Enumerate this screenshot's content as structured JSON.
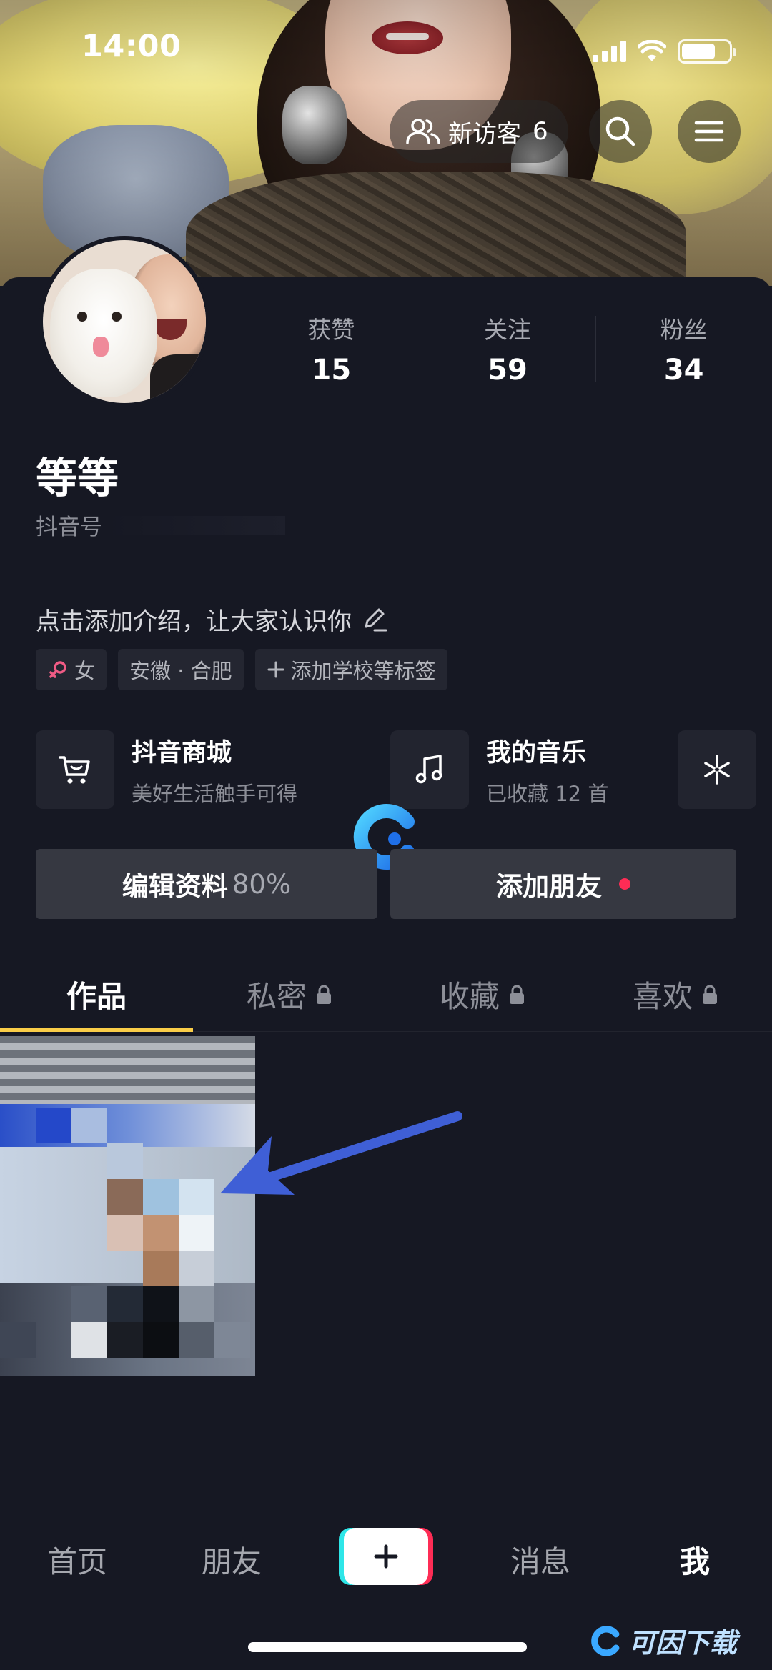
{
  "status_bar": {
    "time": "14:00"
  },
  "header": {
    "visitors_label": "新访客",
    "visitors_count": "6"
  },
  "profile": {
    "stats": [
      {
        "label": "获赞",
        "value": "15"
      },
      {
        "label": "关注",
        "value": "59"
      },
      {
        "label": "粉丝",
        "value": "34"
      }
    ],
    "nickname": "等等",
    "douyin_id": "抖音号",
    "bio": "点击添加介绍，让大家认识你",
    "tags": {
      "gender": "女",
      "location": "安徽 · 合肥",
      "add_school": "添加学校等标签"
    }
  },
  "shortcuts": [
    {
      "title": "抖音商城",
      "subtitle": "美好生活触手可得",
      "icon": "cart-icon"
    },
    {
      "title": "我的音乐",
      "subtitle": "已收藏 12 首",
      "icon": "music-note-icon"
    },
    {
      "icon": "sparkle-icon"
    }
  ],
  "actions": {
    "edit_label": "编辑资料",
    "edit_percent": "80%",
    "add_friend_label": "添加朋友"
  },
  "tabs": [
    {
      "label": "作品",
      "active": true
    },
    {
      "label": "私密",
      "locked": true
    },
    {
      "label": "收藏",
      "locked": true
    },
    {
      "label": "喜欢",
      "locked": true
    }
  ],
  "bottom_nav": {
    "home": "首页",
    "friends": "朋友",
    "messages": "消息",
    "me": "我"
  },
  "watermark": {
    "site": "可因下载"
  },
  "colors": {
    "background": "#161823",
    "accent_yellow": "#facd48",
    "red": "#fe2c55",
    "cyan": "#2ee6e8",
    "arrow_blue": "#3f5fd6"
  }
}
